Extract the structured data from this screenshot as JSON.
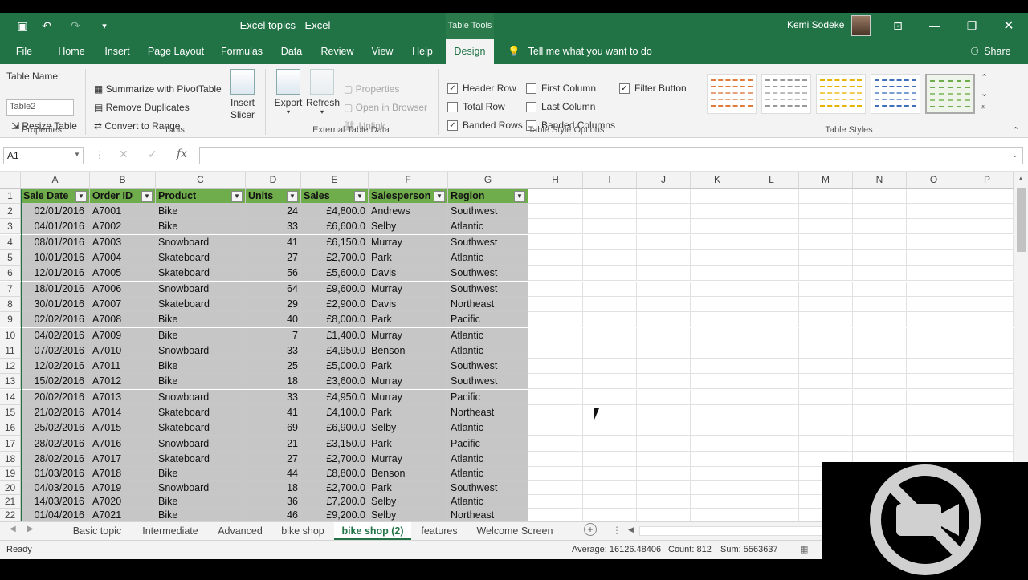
{
  "window": {
    "title": "Excel topics  -  Excel",
    "table_tools": "Table Tools",
    "user": "Kemi Sodeke"
  },
  "tabs": [
    "File",
    "Home",
    "Insert",
    "Page Layout",
    "Formulas",
    "Data",
    "Review",
    "View",
    "Help",
    "Design"
  ],
  "tellme": "Tell me what you want to do",
  "share": "Share",
  "ribbon": {
    "table_name_label": "Table Name:",
    "table_name_value": "Table2",
    "resize_table": "Resize Table",
    "properties_group": "Properties",
    "summarize": "Summarize with PivotTable",
    "remove_duplicates": "Remove Duplicates",
    "convert_to_range": "Convert to Range",
    "tools_group": "Tools",
    "insert_slicer": "Insert Slicer",
    "export": "Export",
    "refresh": "Refresh",
    "properties": "Properties",
    "open_in_browser": "Open in Browser",
    "unlink": "Unlink",
    "external_group": "External Table Data",
    "header_row": "Header Row",
    "total_row": "Total Row",
    "banded_rows": "Banded Rows",
    "first_column": "First Column",
    "last_column": "Last Column",
    "banded_columns": "Banded Columns",
    "filter_button": "Filter Button",
    "options_group": "Table Style Options",
    "styles_group": "Table Styles",
    "checks": {
      "header_row": true,
      "total_row": false,
      "banded_rows": true,
      "first_column": false,
      "last_column": false,
      "banded_columns": false,
      "filter_button": true
    }
  },
  "formula": {
    "namebox": "A1",
    "fx": "fx"
  },
  "columns": [
    "A",
    "B",
    "C",
    "D",
    "E",
    "F",
    "G",
    "H",
    "I",
    "J",
    "K",
    "L",
    "M",
    "N",
    "O",
    "P"
  ],
  "table": {
    "headers": [
      "Sale Date",
      "Order ID",
      "Product",
      "Units",
      "Sales",
      "Salesperson",
      "Region"
    ],
    "rows": [
      [
        "02/01/2016",
        "A7001",
        "Bike",
        "24",
        "£4,800.0",
        "Andrews",
        "Southwest"
      ],
      [
        "04/01/2016",
        "A7002",
        "Bike",
        "33",
        "£6,600.0",
        "Selby",
        "Atlantic"
      ],
      [
        "08/01/2016",
        "A7003",
        "Snowboard",
        "41",
        "£6,150.0",
        "Murray",
        "Southwest"
      ],
      [
        "10/01/2016",
        "A7004",
        "Skateboard",
        "27",
        "£2,700.0",
        "Park",
        "Atlantic"
      ],
      [
        "12/01/2016",
        "A7005",
        "Skateboard",
        "56",
        "£5,600.0",
        "Davis",
        "Southwest"
      ],
      [
        "18/01/2016",
        "A7006",
        "Snowboard",
        "64",
        "£9,600.0",
        "Murray",
        "Southwest"
      ],
      [
        "30/01/2016",
        "A7007",
        "Skateboard",
        "29",
        "£2,900.0",
        "Davis",
        "Northeast"
      ],
      [
        "02/02/2016",
        "A7008",
        "Bike",
        "40",
        "£8,000.0",
        "Park",
        "Pacific"
      ],
      [
        "04/02/2016",
        "A7009",
        "Bike",
        "7",
        "£1,400.0",
        "Murray",
        "Atlantic"
      ],
      [
        "07/02/2016",
        "A7010",
        "Snowboard",
        "33",
        "£4,950.0",
        "Benson",
        "Atlantic"
      ],
      [
        "12/02/2016",
        "A7011",
        "Bike",
        "25",
        "£5,000.0",
        "Park",
        "Southwest"
      ],
      [
        "15/02/2016",
        "A7012",
        "Bike",
        "18",
        "£3,600.0",
        "Murray",
        "Southwest"
      ],
      [
        "20/02/2016",
        "A7013",
        "Snowboard",
        "33",
        "£4,950.0",
        "Murray",
        "Pacific"
      ],
      [
        "21/02/2016",
        "A7014",
        "Skateboard",
        "41",
        "£4,100.0",
        "Park",
        "Northeast"
      ],
      [
        "25/02/2016",
        "A7015",
        "Skateboard",
        "69",
        "£6,900.0",
        "Selby",
        "Atlantic"
      ],
      [
        "28/02/2016",
        "A7016",
        "Snowboard",
        "21",
        "£3,150.0",
        "Park",
        "Pacific"
      ],
      [
        "28/02/2016",
        "A7017",
        "Skateboard",
        "27",
        "£2,700.0",
        "Murray",
        "Atlantic"
      ],
      [
        "01/03/2016",
        "A7018",
        "Bike",
        "44",
        "£8,800.0",
        "Benson",
        "Atlantic"
      ],
      [
        "04/03/2016",
        "A7019",
        "Snowboard",
        "18",
        "£2,700.0",
        "Park",
        "Southwest"
      ],
      [
        "14/03/2016",
        "A7020",
        "Bike",
        "36",
        "£7,200.0",
        "Selby",
        "Atlantic"
      ],
      [
        "01/04/2016",
        "A7021",
        "Bike",
        "46",
        "£9,200.0",
        "Selby",
        "Northeast"
      ]
    ]
  },
  "sheets": [
    "Basic topic",
    "Intermediate",
    "Advanced",
    "bike shop",
    "bike shop (2)",
    "features",
    "Welcome Screen"
  ],
  "active_sheet": "bike shop (2)",
  "status": {
    "ready": "Ready",
    "average": "Average: 16126.48406",
    "count": "Count: 812",
    "sum": "Sum: 5563637"
  },
  "colors": {
    "excel_green": "#217346",
    "table_header": "#6fac4c",
    "table_band": "#c6c6c6"
  }
}
